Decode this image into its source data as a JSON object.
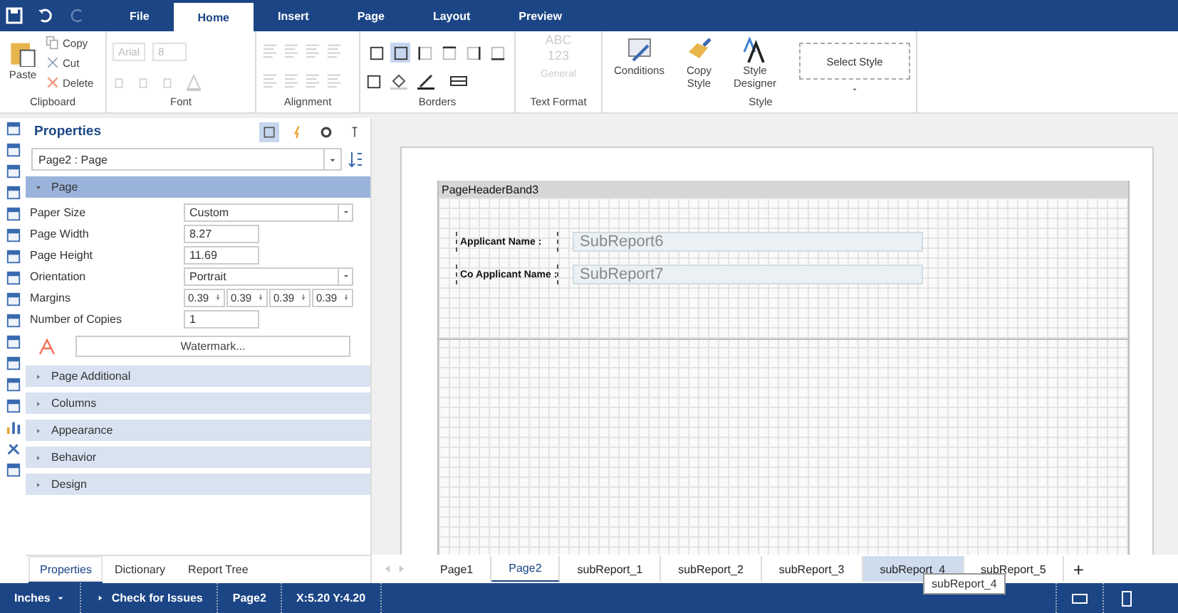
{
  "menu_tabs": [
    {
      "label": "File",
      "selected": false
    },
    {
      "label": "Home",
      "selected": true
    },
    {
      "label": "Insert",
      "selected": false
    },
    {
      "label": "Page",
      "selected": false
    },
    {
      "label": "Layout",
      "selected": false
    },
    {
      "label": "Preview",
      "selected": false
    }
  ],
  "ribbon": {
    "clipboard": {
      "label": "Clipboard",
      "paste": "Paste",
      "actions": [
        {
          "label": "Copy",
          "disabled": true
        },
        {
          "label": "Cut",
          "disabled": true
        },
        {
          "label": "Delete",
          "disabled": true
        }
      ]
    },
    "font": {
      "label": "Font",
      "family": "Arial",
      "size": "8",
      "disabled": true
    },
    "alignment": {
      "label": "Alignment",
      "disabled": true
    },
    "borders": {
      "label": "Borders"
    },
    "text_format": {
      "label": "Text Format",
      "icon_lines": [
        "ABC",
        "123"
      ],
      "value": "General",
      "disabled": true
    },
    "style": {
      "label": "Style",
      "buttons": [
        {
          "kind": "conditions",
          "label": "Conditions"
        },
        {
          "kind": "copy",
          "label": "Copy Style"
        },
        {
          "kind": "designer",
          "label": "Style Designer"
        }
      ],
      "select": "Select Style"
    }
  },
  "properties": {
    "title": "Properties",
    "view_modes": [
      {
        "selected": true
      },
      {
        "selected": false
      },
      {
        "selected": false
      },
      {
        "selected": false
      }
    ],
    "selector": "Page2 : Page",
    "sections": [
      {
        "title": "Page",
        "expanded": true,
        "rows": [
          {
            "label": "Paper Size",
            "kind": "dropdown",
            "value": "Custom"
          },
          {
            "label": "Page Width",
            "kind": "text",
            "value": "8.27"
          },
          {
            "label": "Page Height",
            "kind": "text",
            "value": "11.69"
          },
          {
            "label": "Orientation",
            "kind": "dropdown",
            "value": "Portrait"
          },
          {
            "label": "Margins",
            "kind": "margins",
            "values": [
              "0.39",
              "0.39",
              "0.39",
              "0.39"
            ]
          },
          {
            "label": "Number of Copies",
            "kind": "text",
            "value": "1"
          }
        ],
        "watermark": "Watermark..."
      },
      {
        "title": "Page Additional",
        "expanded": false
      },
      {
        "title": "Columns",
        "expanded": false
      },
      {
        "title": "Appearance",
        "expanded": false
      },
      {
        "title": "Behavior",
        "expanded": false
      },
      {
        "title": "Design",
        "expanded": false
      }
    ],
    "tabs": [
      {
        "label": "Properties",
        "selected": true
      },
      {
        "label": "Dictionary",
        "selected": false
      },
      {
        "label": "Report Tree",
        "selected": false
      }
    ]
  },
  "report": {
    "band": "PageHeaderBand3",
    "fields": [
      {
        "label": "Applicant Name :",
        "value": "SubReport6"
      },
      {
        "label": "Co Applicant Name :",
        "value": "SubReport7"
      }
    ]
  },
  "page_tabs": [
    {
      "label": "Page1",
      "selected": false,
      "highlighted": false
    },
    {
      "label": "Page2",
      "selected": true,
      "highlighted": false
    },
    {
      "label": "subReport_1",
      "selected": false,
      "highlighted": false
    },
    {
      "label": "subReport_2",
      "selected": false,
      "highlighted": false
    },
    {
      "label": "subReport_3",
      "selected": false,
      "highlighted": false
    },
    {
      "label": "subReport_4",
      "selected": false,
      "highlighted": true
    },
    {
      "label": "subReport_5",
      "selected": false,
      "highlighted": false
    }
  ],
  "add_tab": "+",
  "tooltip": "subReport_4",
  "status_bar": {
    "units": "Inches",
    "check": "Check for Issues",
    "page": "Page2",
    "position": "X:5.20 Y:4.20"
  }
}
